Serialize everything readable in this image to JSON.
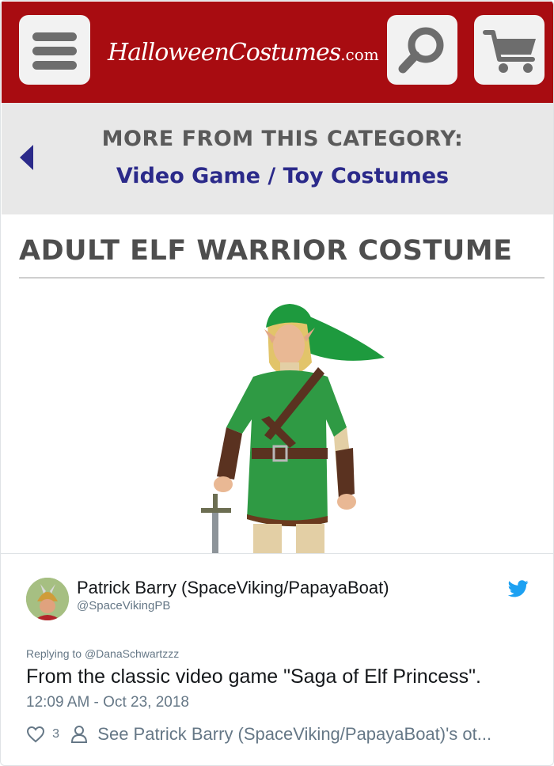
{
  "store": {
    "logo_main": "HalloweenCostumes",
    "logo_domain": ".com",
    "menu_icon": "hamburger-menu-icon",
    "search_icon": "magnifier-icon",
    "cart_icon": "shopping-cart-icon",
    "header_color": "#a80c11"
  },
  "category": {
    "heading": "MORE FROM THIS CATEGORY:",
    "link": "Video Game / Toy Costumes",
    "link_color": "#2b2a8a"
  },
  "product": {
    "title": "ADULT ELF WARRIOR COSTUME",
    "image_subject": "man in green elf warrior tunic and cap holding a sword"
  },
  "tweet": {
    "author_name": "Patrick Barry (SpaceViking/PapayaBoat)",
    "author_handle": "@SpaceVikingPB",
    "replying_to_prefix": "Replying to ",
    "replying_to_handle": "@DanaSchwartzzz",
    "text": "From the classic video game \"Saga of Elf Princess\".",
    "timestamp": "12:09 AM - Oct 23, 2018",
    "like_count": "3",
    "see_more": "See Patrick Barry (SpaceViking/PapayaBoat)'s ot..."
  },
  "colors": {
    "twitter_blue": "#1da1f2",
    "secondary_text": "#657786"
  }
}
